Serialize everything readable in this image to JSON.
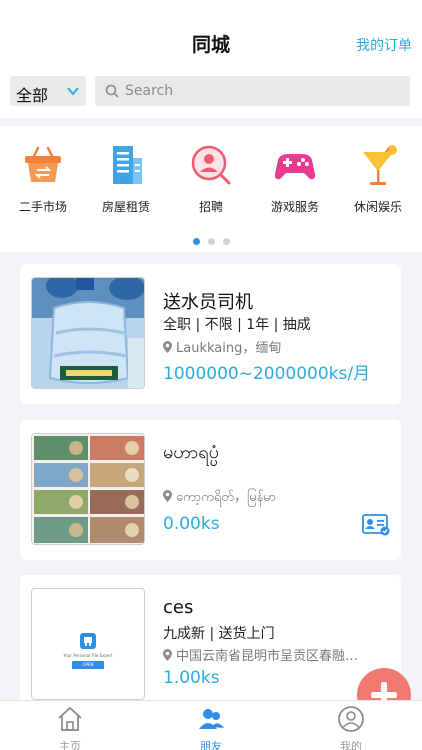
{
  "header": {
    "title": "同城",
    "orders_label": "我的订单"
  },
  "filter": {
    "selected": "全部"
  },
  "search": {
    "placeholder": "Search"
  },
  "categories": [
    {
      "label": "二手市场",
      "icon": "shopping-basket-icon"
    },
    {
      "label": "房屋租赁",
      "icon": "building-icon"
    },
    {
      "label": "招聘",
      "icon": "recruit-person-icon"
    },
    {
      "label": "游戏服务",
      "icon": "gamepad-icon"
    },
    {
      "label": "休闲娱乐",
      "icon": "cocktail-icon"
    }
  ],
  "pager": {
    "pages": 3,
    "active": 1
  },
  "listings": [
    {
      "title": "送水员司机",
      "tags": "全职 | 不限 | 1年 | 抽成",
      "location": "Laukkaing，缅甸",
      "price": "1000000~2000000ks/月",
      "image": "water-jug-photo"
    },
    {
      "title": "မဟာရပ္ပံ",
      "tags": "",
      "location": "ကော့ကရိတ်，မြန်မာ",
      "price": "0.00ks",
      "image": "banknotes-photo",
      "badge": "id-card-icon"
    },
    {
      "title": "ces",
      "tags": "九成新 | 送货上门",
      "location": "中国云南省昆明市呈贡区春融…",
      "price": "1.00ks",
      "image": "app-screenshot",
      "thumb_text": "Your Personal File Expert",
      "thumb_button": "OPEN"
    }
  ],
  "tabbar": [
    {
      "label": "主页",
      "icon": "home-icon"
    },
    {
      "label": "朋友",
      "icon": "friends-icon",
      "active": true
    },
    {
      "label": "我的",
      "icon": "profile-icon"
    }
  ],
  "colors": {
    "accent": "#2eaadf",
    "tab_active": "#2f8fe6",
    "fab": "#f07a72"
  }
}
